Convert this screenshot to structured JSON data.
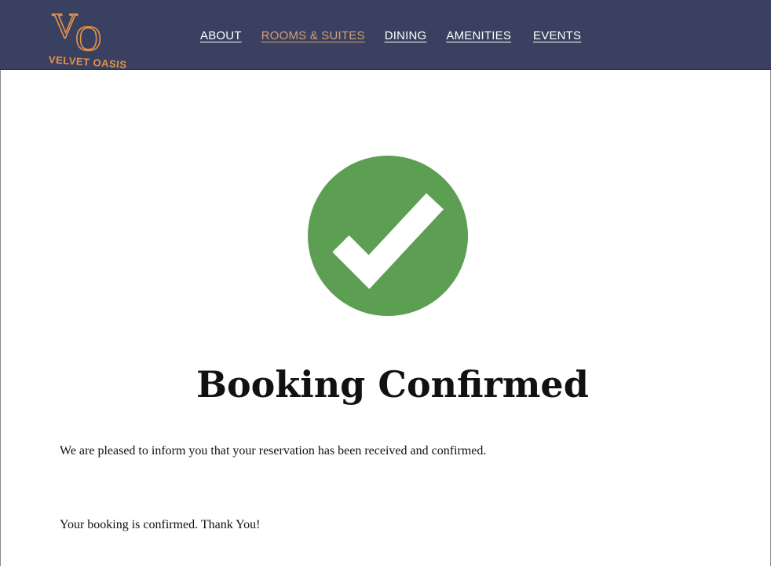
{
  "header": {
    "logo": {
      "monogram": "VO",
      "name": "VELVET OASIS"
    },
    "nav": [
      {
        "label": "ABOUT"
      },
      {
        "label": "ROOMS & SUITES",
        "active": true
      },
      {
        "label": "DINING"
      },
      {
        "label": "AMENITIES"
      },
      {
        "label": "EVENTS"
      }
    ]
  },
  "colors": {
    "header_bg": "#3a4160",
    "accent": "#e8924a",
    "nav_active": "#d1a07a",
    "success": "#5c9e52"
  },
  "confirmation": {
    "icon": "checkmark-circle-icon",
    "title": "Booking Confirmed",
    "message": "We are pleased to inform you that your reservation has been received and confirmed.",
    "note": "Your booking is confirmed. Thank You!"
  }
}
